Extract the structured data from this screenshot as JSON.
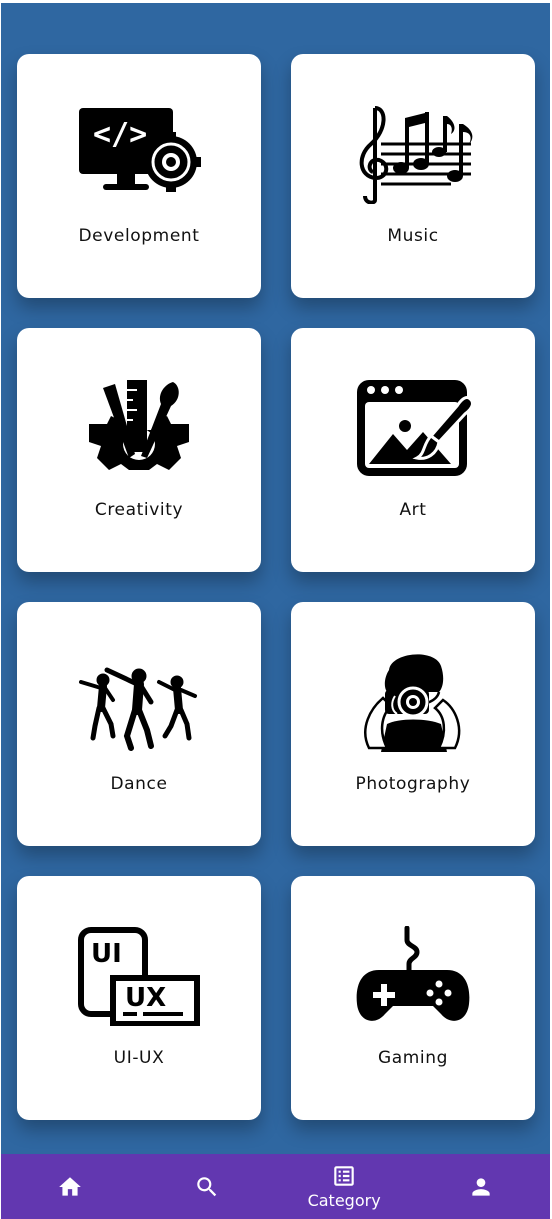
{
  "categories": [
    {
      "label": "Development",
      "icon": "development-icon"
    },
    {
      "label": "Music",
      "icon": "music-icon"
    },
    {
      "label": "Creativity",
      "icon": "creativity-icon"
    },
    {
      "label": "Art",
      "icon": "art-icon"
    },
    {
      "label": "Dance",
      "icon": "dance-icon"
    },
    {
      "label": "Photography",
      "icon": "photography-icon"
    },
    {
      "label": "UI-UX",
      "icon": "ui-ux-icon"
    },
    {
      "label": "Gaming",
      "icon": "gaming-icon"
    }
  ],
  "bottom_nav": {
    "items": [
      {
        "icon": "home-icon",
        "label": ""
      },
      {
        "icon": "search-icon",
        "label": ""
      },
      {
        "icon": "category-icon",
        "label": "Category"
      },
      {
        "icon": "person-icon",
        "label": ""
      }
    ],
    "active": "Category"
  },
  "colors": {
    "background": "#2f67a1",
    "card": "#ffffff",
    "bottom_nav": "#6237b0",
    "icon": "#000000"
  }
}
